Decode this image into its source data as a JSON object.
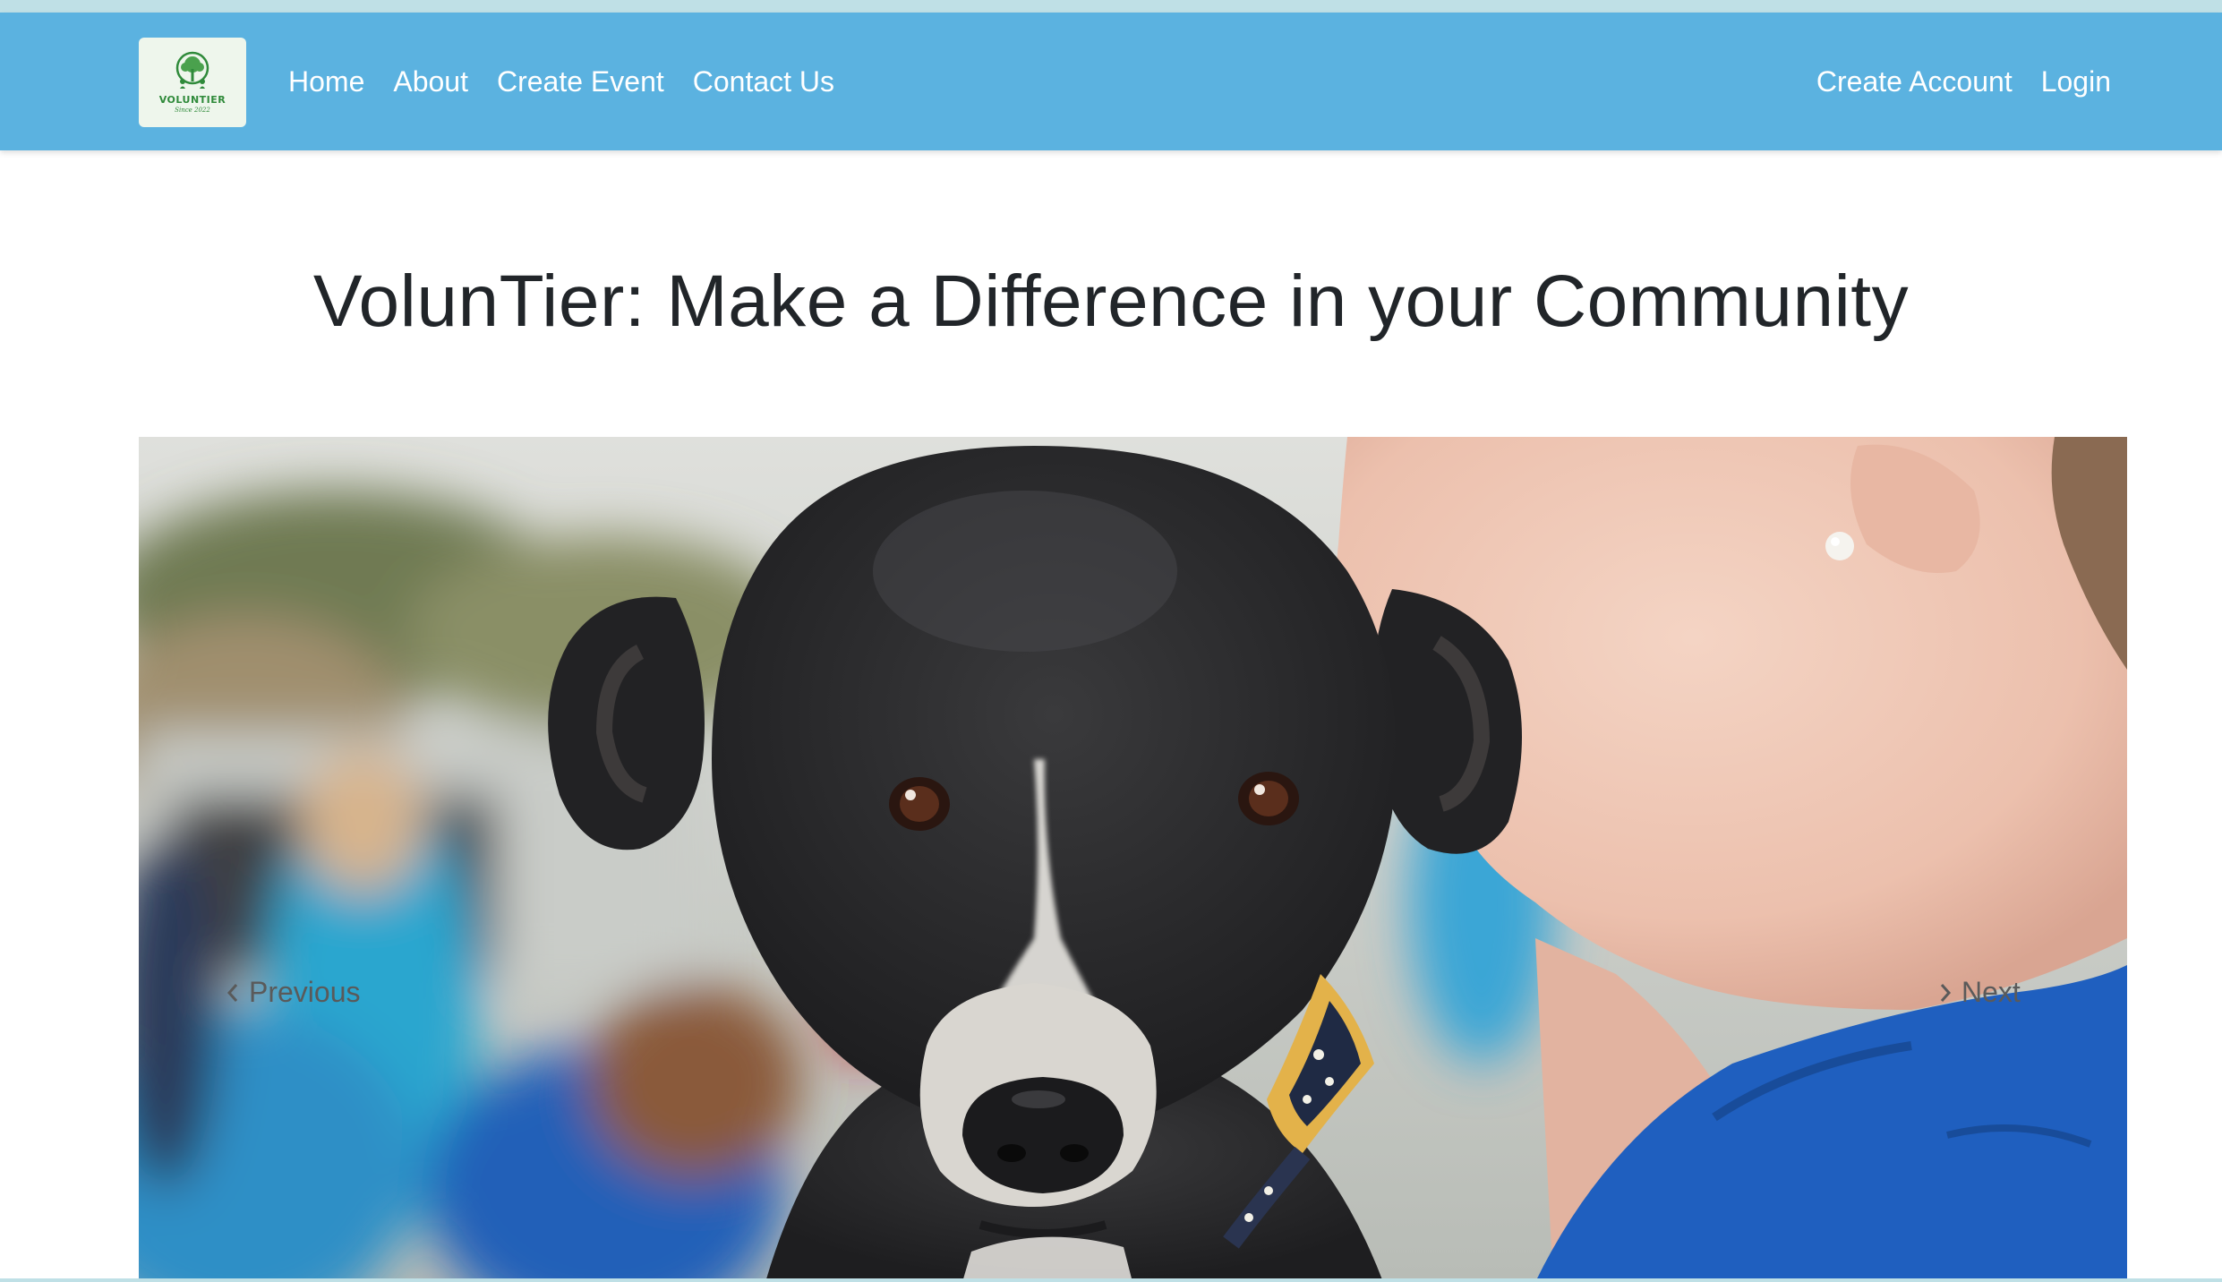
{
  "logo": {
    "name": "VOLUNTIER",
    "tagline": "Since 2022",
    "icon": "tree-icon"
  },
  "nav": {
    "left_links": [
      "Home",
      "About",
      "Create Event",
      "Contact Us"
    ],
    "right_links": [
      "Create Account",
      "Login"
    ]
  },
  "hero": {
    "title": "VolunTier: Make a Difference in your Community"
  },
  "carousel": {
    "prev_label": "Previous",
    "next_label": "Next",
    "prev_icon": "chevron-left-icon",
    "next_icon": "chevron-right-icon",
    "slide_image": "puppy-photo"
  },
  "colors": {
    "navbar": "#5bb2e0",
    "title_text": "#212529",
    "nav_text": "#ffffff",
    "logo_green": "#2f8a3a"
  }
}
